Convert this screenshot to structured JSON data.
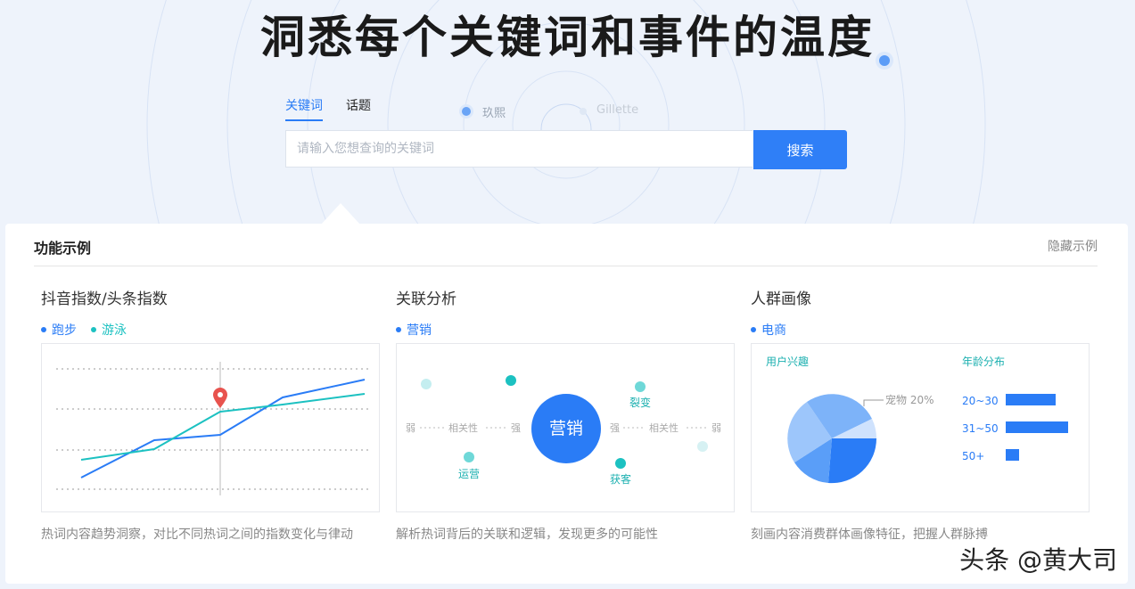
{
  "hero": {
    "title": "洞悉每个关键词和事件的温度"
  },
  "floating_tags": [
    "玖熙",
    "Gillette"
  ],
  "search": {
    "tabs": [
      "关键词",
      "话题"
    ],
    "active_tab": 0,
    "placeholder": "请输入您想查询的关键词",
    "button_label": "搜索"
  },
  "panel": {
    "title": "功能示例",
    "hide_label": "隐藏示例",
    "cards": [
      {
        "title": "抖音指数/头条指数",
        "legend": [
          {
            "label": "跑步",
            "color": "#2a7cf6"
          },
          {
            "label": "游泳",
            "color": "#1cc1c1"
          }
        ],
        "desc": "热词内容趋势洞察，对比不同热词之间的指数变化与律动"
      },
      {
        "title": "关联分析",
        "legend": [
          {
            "label": "营销",
            "color": "#2a7cf6"
          }
        ],
        "center": "营销",
        "nodes": [
          "裂变",
          "运营",
          "获客"
        ],
        "scale_labels": [
          "弱",
          "相关性",
          "强",
          "强",
          "相关性",
          "弱"
        ],
        "desc": "解析热词背后的关联和逻辑，发现更多的可能性"
      },
      {
        "title": "人群画像",
        "legend": [
          {
            "label": "电商",
            "color": "#2a7cf6"
          }
        ],
        "interest_title": "用户兴趣",
        "pie_label": "宠物 20%",
        "age_title": "年龄分布",
        "age_groups": [
          {
            "label": "20~30",
            "value": 56
          },
          {
            "label": "31~50",
            "value": 70
          },
          {
            "label": "50+",
            "value": 15
          }
        ],
        "desc": "刻画内容消费群体画像特征，把握人群脉搏"
      }
    ]
  },
  "watermark": "头条 @黄大司"
}
